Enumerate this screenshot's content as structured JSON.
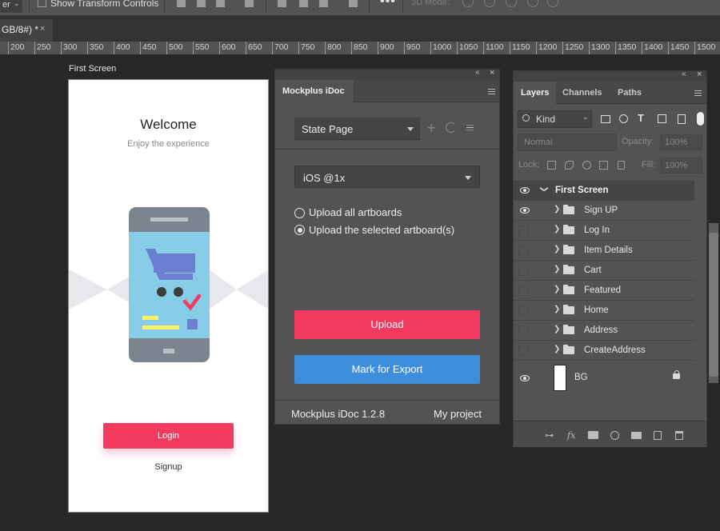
{
  "optionsbar": {
    "select_value": "er",
    "show_transform_label": "Show Transform Controls",
    "more_label": "•••",
    "mode_label": "3D Mode:"
  },
  "document_tab": {
    "title": "GB/8#) *",
    "close_glyph": "×"
  },
  "ruler": {
    "labels": [
      "200",
      "250",
      "300",
      "350",
      "400",
      "450",
      "500",
      "550",
      "600",
      "650",
      "700",
      "750",
      "800",
      "850",
      "900",
      "950",
      "1000",
      "1050",
      "1100",
      "1150",
      "1200",
      "1250",
      "1300",
      "1350",
      "1400",
      "1450",
      "1500"
    ]
  },
  "artboard": {
    "title": "First Screen",
    "welcome": "Welcome",
    "subtitle": "Enjoy the experience",
    "login_label": "Login",
    "signup_label": "Signup",
    "colors": {
      "accent": "#f43a5f",
      "phone_body": "#7b858f",
      "screen": "#87cde8",
      "cart": "#6b7fd1",
      "check": "#f43a5f",
      "note": "#fff06a",
      "deco": "#e6e8ec"
    }
  },
  "mockplus": {
    "tab": "Mockplus iDoc",
    "state_select": "State Page",
    "device_select": "iOS @1x",
    "radio_all": "Upload all artboards",
    "radio_selected": "Upload the selected artboard(s)",
    "selected_option": "selected",
    "upload_label": "Upload",
    "mark_label": "Mark for Export",
    "version": "Mockplus iDoc 1.2.8",
    "project": "My project",
    "colors": {
      "upload": "#f43a5f",
      "mark": "#3d8fdd"
    }
  },
  "layers_panel": {
    "tabs": [
      "Layers",
      "Channels",
      "Paths"
    ],
    "filter_kind": "Kind",
    "blend_mode": "Normal",
    "opacity_label": "Opacity:",
    "opacity_value": "100%",
    "lock_label": "Lock:",
    "fill_label": "Fill:",
    "fill_value": "100%",
    "group_name": "First Screen",
    "layers": [
      {
        "name": "Sign UP",
        "visible": true
      },
      {
        "name": "Log In",
        "visible": false
      },
      {
        "name": "Item Details",
        "visible": false
      },
      {
        "name": "Cart",
        "visible": false
      },
      {
        "name": "Featured",
        "visible": false
      },
      {
        "name": "Home",
        "visible": false
      },
      {
        "name": "Address",
        "visible": false
      },
      {
        "name": "CreateAddress",
        "visible": false
      }
    ],
    "bg_layer": "BG",
    "bottom_icons": [
      "link-icon",
      "fx-icon",
      "mask-icon",
      "adjustment-icon",
      "folder-icon",
      "new-layer-icon",
      "trash-icon"
    ],
    "fx_label": "fx"
  }
}
